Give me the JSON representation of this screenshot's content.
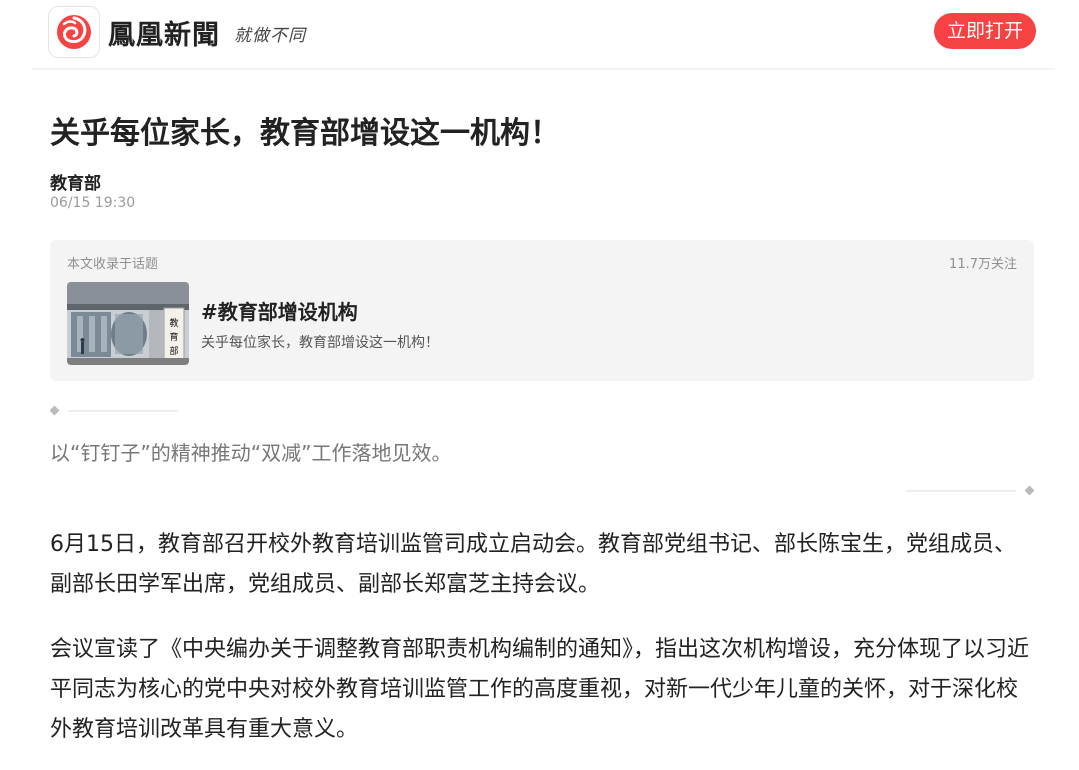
{
  "header": {
    "brand_name": "鳳凰新聞",
    "slogan": "就做不同",
    "open_button_label": "立即打开",
    "accent_color": "#f54343"
  },
  "article": {
    "title": "关乎每位家长，教育部增设这一机构！",
    "author": "教育部",
    "publish_time": "06/15 19:30"
  },
  "topic": {
    "caption": "本文收录于话题",
    "followers": "11.7万关注",
    "name": "#教育部增设机构",
    "description": "关乎每位家长，教育部增设这一机构！",
    "thumbnail_sign_text": "教育部"
  },
  "summary": "以“钉钉子”的精神推动“双减”工作落地见效。",
  "paragraphs": [
    "6月15日，教育部召开校外教育培训监管司成立启动会。教育部党组书记、部长陈宝生，党组成员、副部长田学军出席，党组成员、副部长郑富芝主持会议。",
    "会议宣读了《中央编办关于调整教育部职责机构编制的通知》，指出这次机构增设，充分体现了以习近平同志为核心的党中央对校外教育培训监管工作的高度重视，对新一代少年儿童的关怀，对于深化校外教育培训改革具有重大意义。"
  ]
}
